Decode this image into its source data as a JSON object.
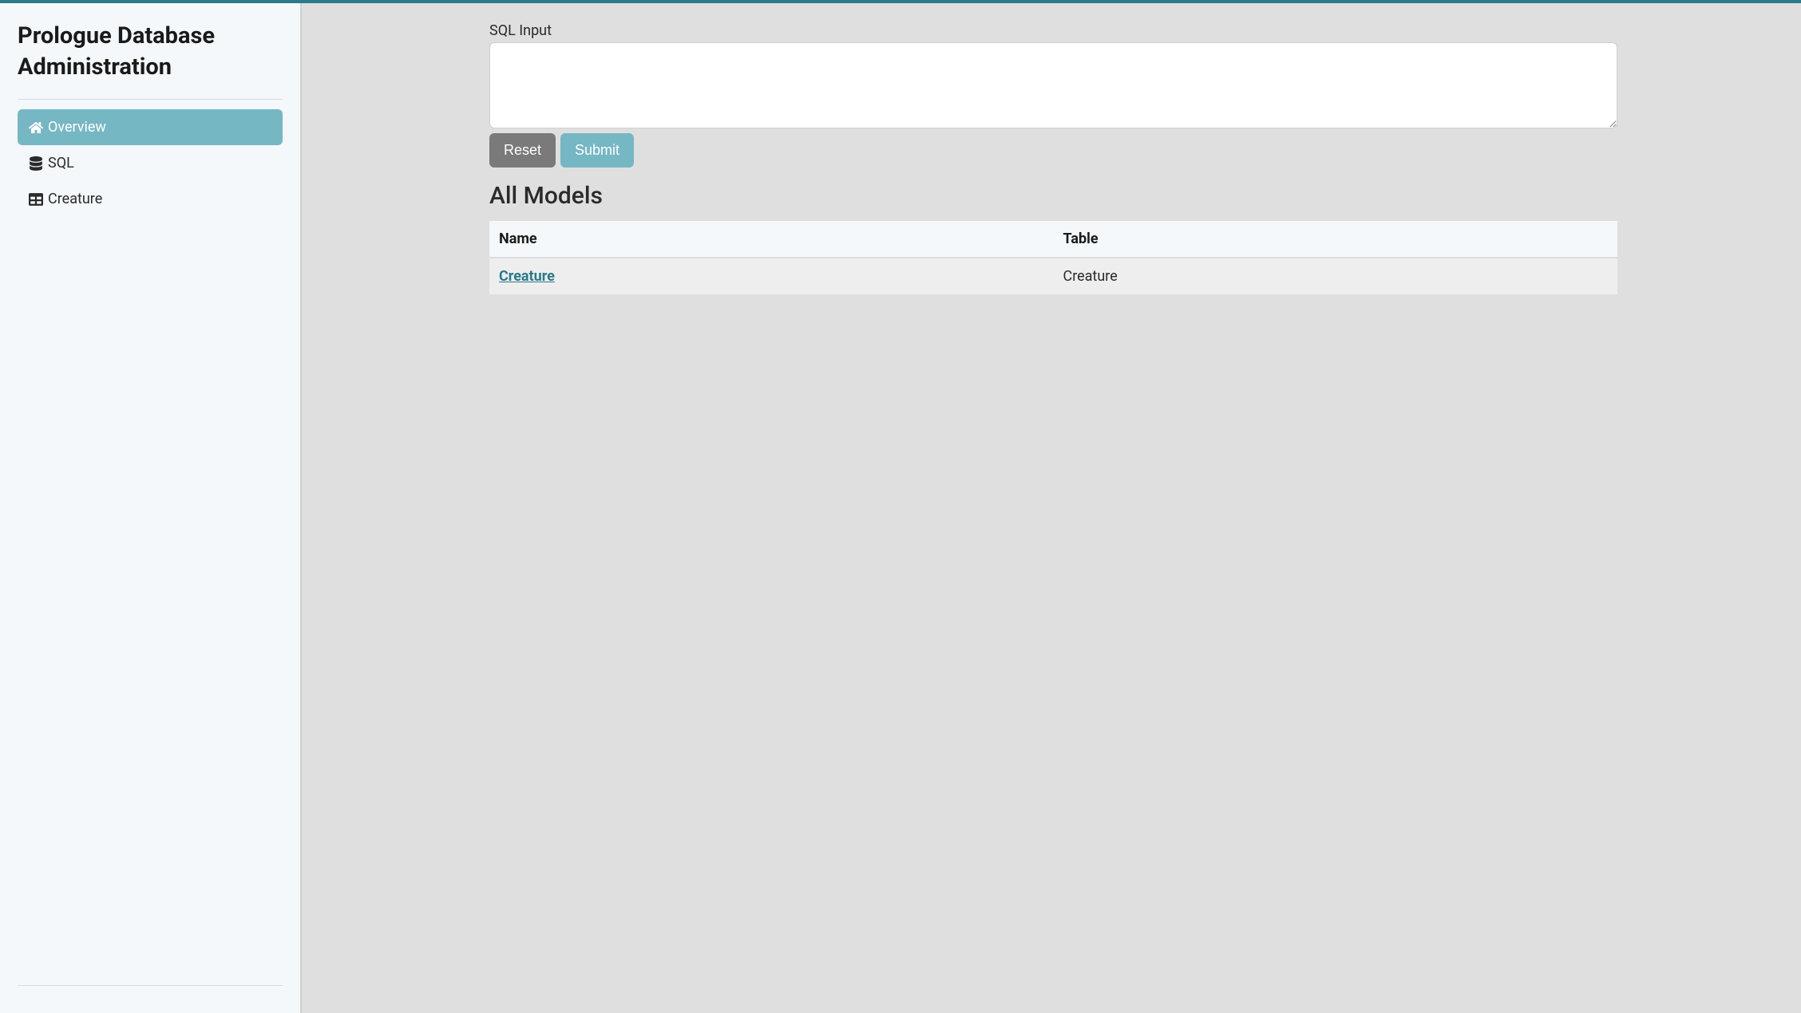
{
  "sidebar": {
    "title": "Prologue Database Administration",
    "items": [
      {
        "label": "Overview",
        "icon": "home-icon",
        "active": true
      },
      {
        "label": "SQL",
        "icon": "database-icon",
        "active": false
      },
      {
        "label": "Creature",
        "icon": "table-icon",
        "active": false
      }
    ]
  },
  "main": {
    "sql_input_label": "SQL Input",
    "sql_input_value": "",
    "reset_label": "Reset",
    "submit_label": "Submit",
    "section_title": "All Models",
    "table": {
      "columns": [
        "Name",
        "Table"
      ],
      "rows": [
        {
          "name": "Creature",
          "table": "Creature"
        }
      ]
    }
  }
}
